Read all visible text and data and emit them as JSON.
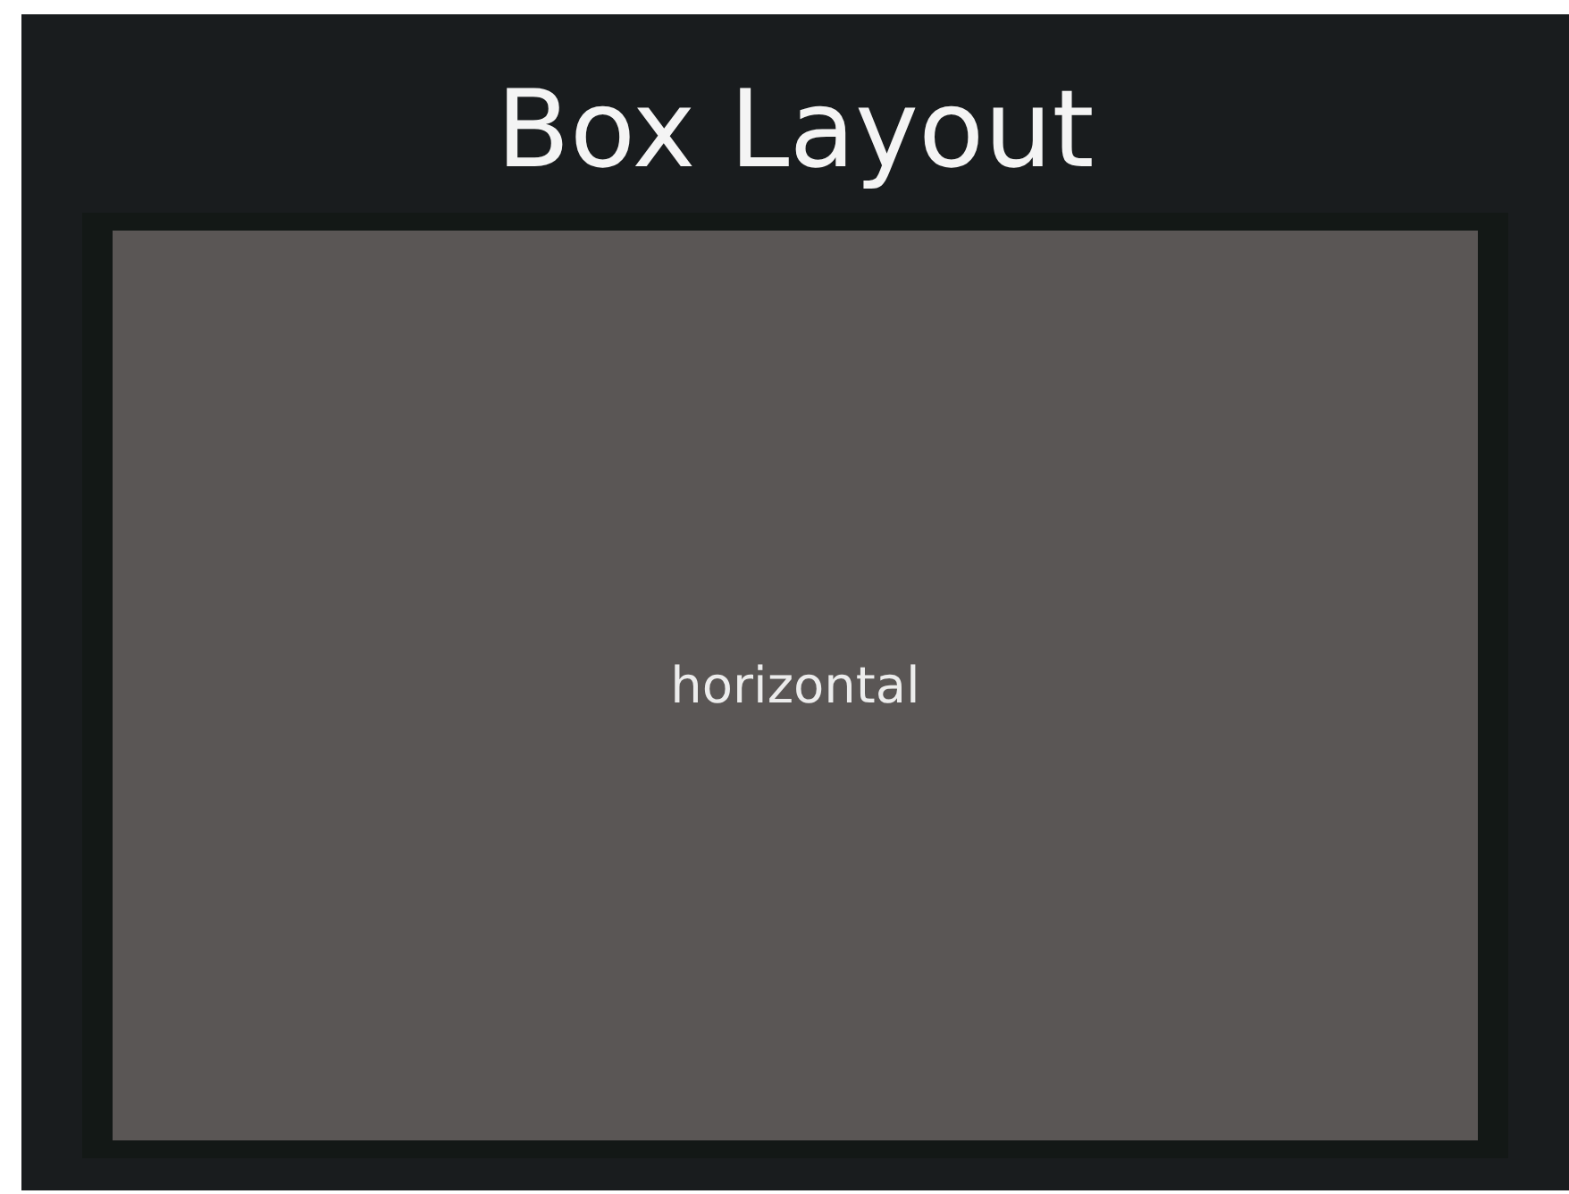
{
  "title": "Box Layout",
  "box": {
    "label": "horizontal"
  }
}
